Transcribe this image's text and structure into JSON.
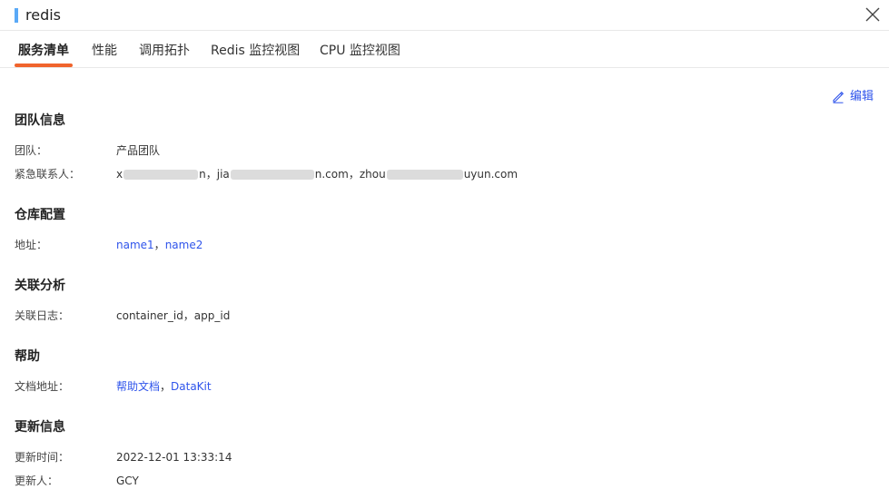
{
  "header": {
    "title": "redis"
  },
  "tabs": [
    {
      "label": "服务清单"
    },
    {
      "label": "性能"
    },
    {
      "label": "调用拓扑"
    },
    {
      "label": "Redis 监控视图"
    },
    {
      "label": "CPU 监控视图"
    }
  ],
  "edit_label": "编辑",
  "team_section": {
    "title": "团队信息",
    "team_label": "团队：",
    "team_value": "产品团队",
    "contact_label": "紧急联系人：",
    "contacts": [
      {
        "prefix": "x",
        "suffix": "n"
      },
      {
        "prefix": "jia",
        "suffix": "n.com"
      },
      {
        "prefix": "zhou",
        "suffix": "uyun.com"
      }
    ],
    "separator": "，"
  },
  "repo_section": {
    "title": "仓库配置",
    "address_label": "地址：",
    "addresses": [
      "name1",
      "name2"
    ]
  },
  "related_section": {
    "title": "关联分析",
    "log_label": "关联日志：",
    "logs": "container_id，app_id"
  },
  "help_section": {
    "title": "帮助",
    "doc_label": "文档地址：",
    "docs": [
      "帮助文档",
      "DataKit"
    ]
  },
  "update_section": {
    "title": "更新信息",
    "time_label": "更新时间：",
    "time_value": "2022-12-01 13:33:14",
    "user_label": "更新人：",
    "user_value": "GCY"
  },
  "colors": {
    "accent": "#f0642c",
    "link": "#2f54eb",
    "title_bar": "#5aa9f7"
  }
}
